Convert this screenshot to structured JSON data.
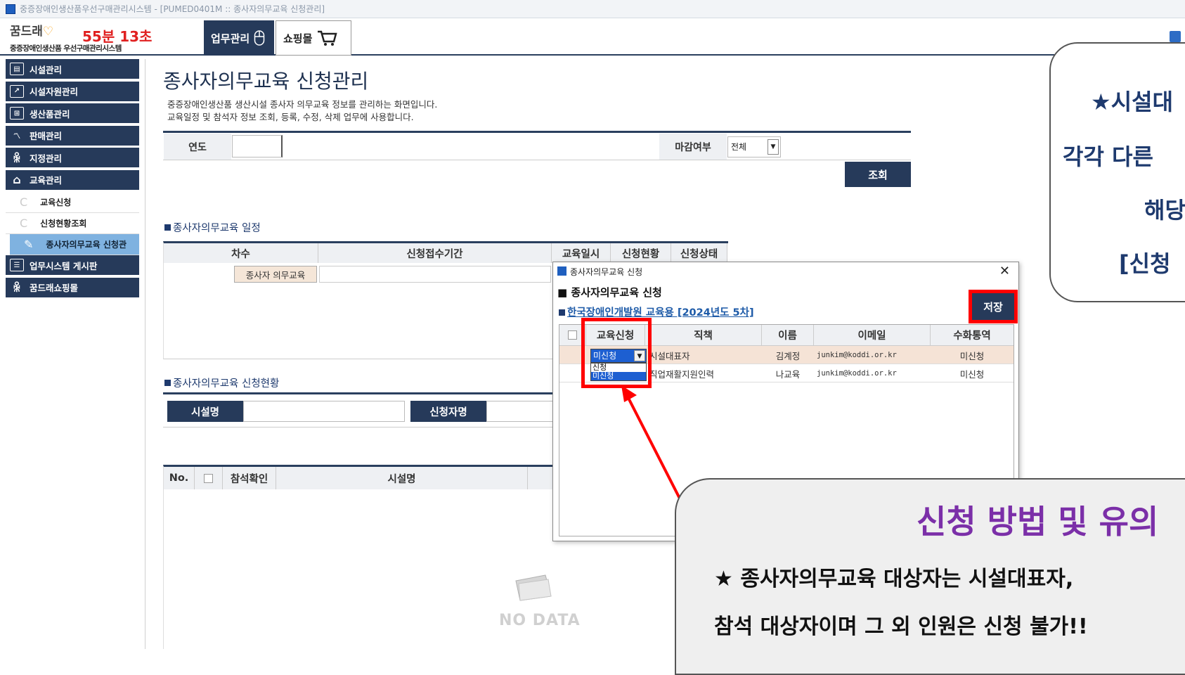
{
  "window": {
    "title": "중증장애인생산품우선구매관리시스템 - [PUMED0401M :: 종사자의무교육 신청관리]"
  },
  "header": {
    "logo_brand": "꿈드래",
    "logo_sub": "중증장애인생산품 우선구매관리시스템",
    "timer": "55분 13초",
    "btn_work": "업무관리",
    "btn_shop": "쇼핑몰"
  },
  "sidebar": {
    "items": [
      {
        "label": "시설관리"
      },
      {
        "label": "시설자원관리"
      },
      {
        "label": "생산품관리"
      },
      {
        "label": "판매관리"
      },
      {
        "label": "지정관리"
      },
      {
        "label": "교육관리"
      }
    ],
    "subitems": [
      {
        "label": "교육신청"
      },
      {
        "label": "신청현황조회"
      },
      {
        "label": "종사자의무교육 신청관"
      }
    ],
    "items2": [
      {
        "label": "업무시스템 게시판"
      },
      {
        "label": "꿈드래쇼핑몰"
      }
    ]
  },
  "page": {
    "title": "종사자의무교육 신청관리",
    "desc1": "중증장애인생산품 생산시설 종사자 의무교육 정보를 관리하는 화면입니다.",
    "desc2": "교육일정 및 참석자 정보 조회, 등록, 수정, 삭제 업무에 사용합니다."
  },
  "search": {
    "year_label": "연도",
    "deadline_label": "마감여부",
    "deadline_value": "전체",
    "search_button": "조회"
  },
  "schedule": {
    "section_title": "종사자의무교육 일정",
    "headers": [
      "차수",
      "신청접수기간",
      "교육일시",
      "신청현황",
      "신청상태"
    ],
    "row_label": "종사자 의무교육"
  },
  "status": {
    "section_title": "종사자의무교육 신청현황",
    "facility_label": "시설명",
    "applicant_label": "신청자명",
    "headers": [
      "No.",
      "참석확인",
      "시설명"
    ],
    "nodata": "NO DATA"
  },
  "dialog": {
    "title": "종사자의무교육 신청",
    "heading": "종사자의무교육 신청",
    "subheading": "한국장애인개발원 교육용 [2024년도 5차]",
    "save_button": "저장",
    "headers": [
      "교육신청",
      "직책",
      "이름",
      "이메일",
      "수화통역"
    ],
    "rows": [
      {
        "apply": "미신청",
        "position": "시설대표자",
        "name": "김계정",
        "email": "junkim@koddi.or.kr",
        "sign": "미신청"
      },
      {
        "apply": "",
        "position": "직업재활지원인력",
        "name": "나교육",
        "email": "junkim@koddi.or.kr",
        "sign": "미신청"
      }
    ],
    "dropdown_options": [
      "신청",
      "미신청"
    ]
  },
  "callout_top": {
    "line1": "★시설대",
    "line2": "각각 다른",
    "line3": "해당",
    "line4": "[신청"
  },
  "callout_bottom": {
    "title": "신청 방법 및 유의",
    "line1": "★ 종사자의무교육 대상자는 시설대표자,",
    "line2": "참석 대상자이며 그 외 인원은 신청 불가!!"
  },
  "colors": {
    "navy": "#263a5a",
    "red": "#ff0000",
    "purple": "#7b2fa8"
  }
}
